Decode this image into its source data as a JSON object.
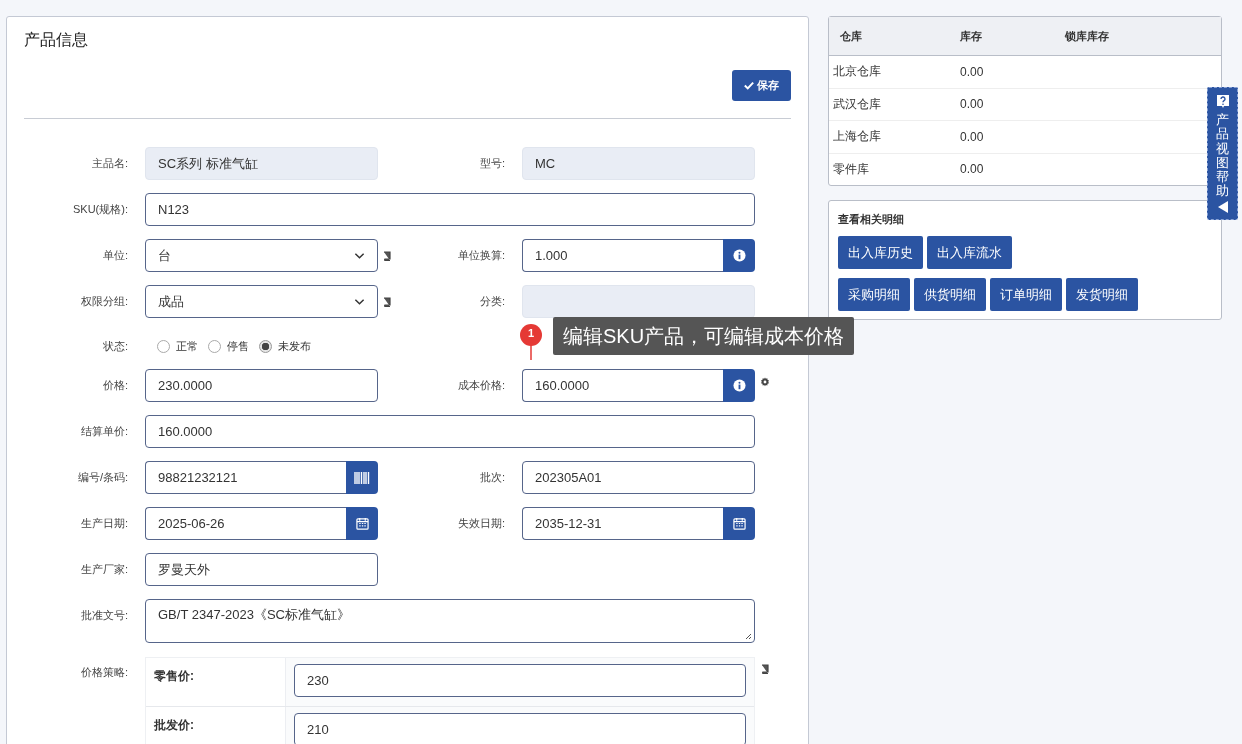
{
  "panel": {
    "title": "产品信息",
    "save_button": "保存"
  },
  "rows": [
    [
      {
        "label": "主品名:",
        "kind": "readonly",
        "value": "SC系列 标准气缸"
      },
      {
        "label": "型号:",
        "kind": "readonly",
        "value": "MC"
      }
    ],
    [
      {
        "label": "SKU(规格):",
        "kind": "text",
        "wide": true,
        "value": "N123"
      }
    ],
    [
      {
        "label": "单位:",
        "kind": "select-book",
        "value": "台"
      },
      {
        "label": "单位换算:",
        "kind": "info-addon",
        "value": "1.000"
      }
    ],
    [
      {
        "label": "权限分组:",
        "kind": "select-book",
        "value": "成品"
      },
      {
        "label": "分类:",
        "kind": "readonly"
      }
    ],
    [
      {
        "label": "状态:",
        "kind": "radio",
        "options": [
          {
            "label": "正常",
            "selected": false
          },
          {
            "label": "停售",
            "selected": false
          },
          {
            "label": "未发布",
            "selected": true
          }
        ]
      }
    ],
    [
      {
        "label": "价格:",
        "kind": "text",
        "value": "230.0000"
      },
      {
        "label": "成本价格:",
        "kind": "info-addon-gear",
        "value": "160.0000"
      }
    ],
    [
      {
        "label": "结算单价:",
        "kind": "text",
        "wide": true,
        "value": "160.0000"
      }
    ],
    [
      {
        "label": "编号/条码:",
        "kind": "barcode-addon",
        "value": "98821232121"
      },
      {
        "label": "批次:",
        "kind": "text",
        "value": "202305A01"
      }
    ],
    [
      {
        "label": "生产日期:",
        "kind": "date",
        "value": "2025-06-26"
      },
      {
        "label": "失效日期:",
        "kind": "date",
        "value": "2035-12-31"
      }
    ],
    [
      {
        "label": "生产厂家:",
        "kind": "text",
        "value": "罗曼天外"
      }
    ],
    [
      {
        "label": "批准文号:",
        "kind": "textarea",
        "wide": true,
        "value": "GB/T 2347-2023《SC标准气缸》"
      }
    ],
    [
      {
        "label": "价格策略:",
        "kind": "price-table",
        "wide": true,
        "rows": [
          {
            "label": "零售价:",
            "value": "230"
          },
          {
            "label": "批发价:",
            "value": "210"
          }
        ]
      }
    ]
  ],
  "tour": {
    "step": "1",
    "text": "编辑SKU产品，可编辑成本价格"
  },
  "stock_table": {
    "columns": [
      "仓库",
      "库存",
      "锁库库存"
    ],
    "rows": [
      [
        "北京仓库",
        "0.00"
      ],
      [
        "武汉仓库",
        "0.00"
      ],
      [
        "上海仓库",
        "0.00"
      ],
      [
        "零件库",
        "0.00"
      ]
    ]
  },
  "details": {
    "title": "查看相关明细",
    "button_rows": [
      [
        "出入库历史",
        "出入库流水"
      ],
      [
        "采购明细",
        "供货明细",
        "订单明细",
        "发货明细"
      ]
    ]
  },
  "help_tab": {
    "text": "产品视图帮助"
  }
}
